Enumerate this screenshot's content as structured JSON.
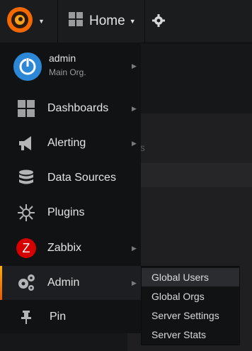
{
  "topbar": {
    "home_label": "Home",
    "logo_icon": "grafana-logo-icon",
    "settings_icon": "gear-icon"
  },
  "background": {
    "ghost_text": "ds"
  },
  "user": {
    "name": "admin",
    "org": "Main Org."
  },
  "menu": {
    "items": [
      {
        "label": "Dashboards",
        "icon": "dashboards-grid-icon"
      },
      {
        "label": "Alerting",
        "icon": "megaphone-icon"
      },
      {
        "label": "Data Sources",
        "icon": "database-icon"
      },
      {
        "label": "Plugins",
        "icon": "plugins-icon"
      },
      {
        "label": "Zabbix",
        "icon": "zabbix-icon"
      },
      {
        "label": "Admin",
        "icon": "cogs-icon"
      },
      {
        "label": "Pin",
        "icon": "pin-icon"
      }
    ]
  },
  "admin_submenu": {
    "items": [
      "Global Users",
      "Global Orgs",
      "Server Settings",
      "Server Stats"
    ]
  },
  "colors": {
    "accent": "#ffad00",
    "zabbix_red": "#d40000",
    "avatar_blue": "#2c88d7"
  }
}
